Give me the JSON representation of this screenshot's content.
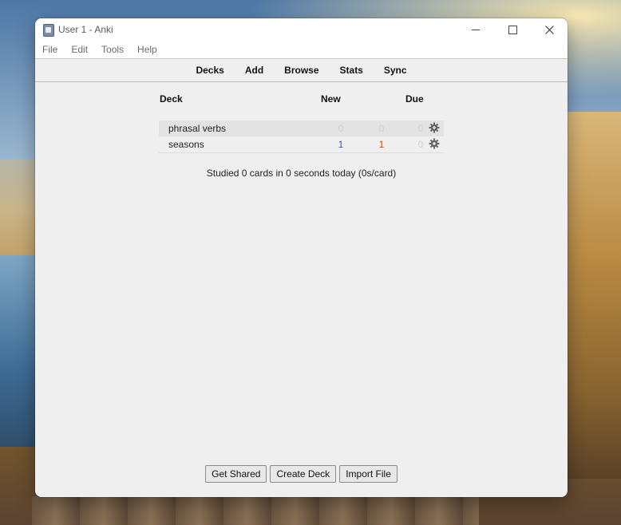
{
  "window": {
    "title": "User 1 - Anki"
  },
  "menubar": [
    "File",
    "Edit",
    "Tools",
    "Help"
  ],
  "toolbar": [
    "Decks",
    "Add",
    "Browse",
    "Stats",
    "Sync"
  ],
  "deck_table": {
    "headers": {
      "deck": "Deck",
      "new": "New",
      "due": "Due"
    },
    "rows": [
      {
        "name": "phrasal verbs",
        "new": "0",
        "learn": "0",
        "due": "0"
      },
      {
        "name": "seasons",
        "new": "1",
        "learn": "1",
        "due": "0"
      }
    ]
  },
  "studied_text": "Studied 0 cards in 0 seconds today (0s/card)",
  "buttons": {
    "get_shared": "Get Shared",
    "create_deck": "Create Deck",
    "import_file": "Import File"
  },
  "colors": {
    "new": "#3f51b5",
    "learn": "#c35617",
    "zero": "#cfcfcf"
  }
}
